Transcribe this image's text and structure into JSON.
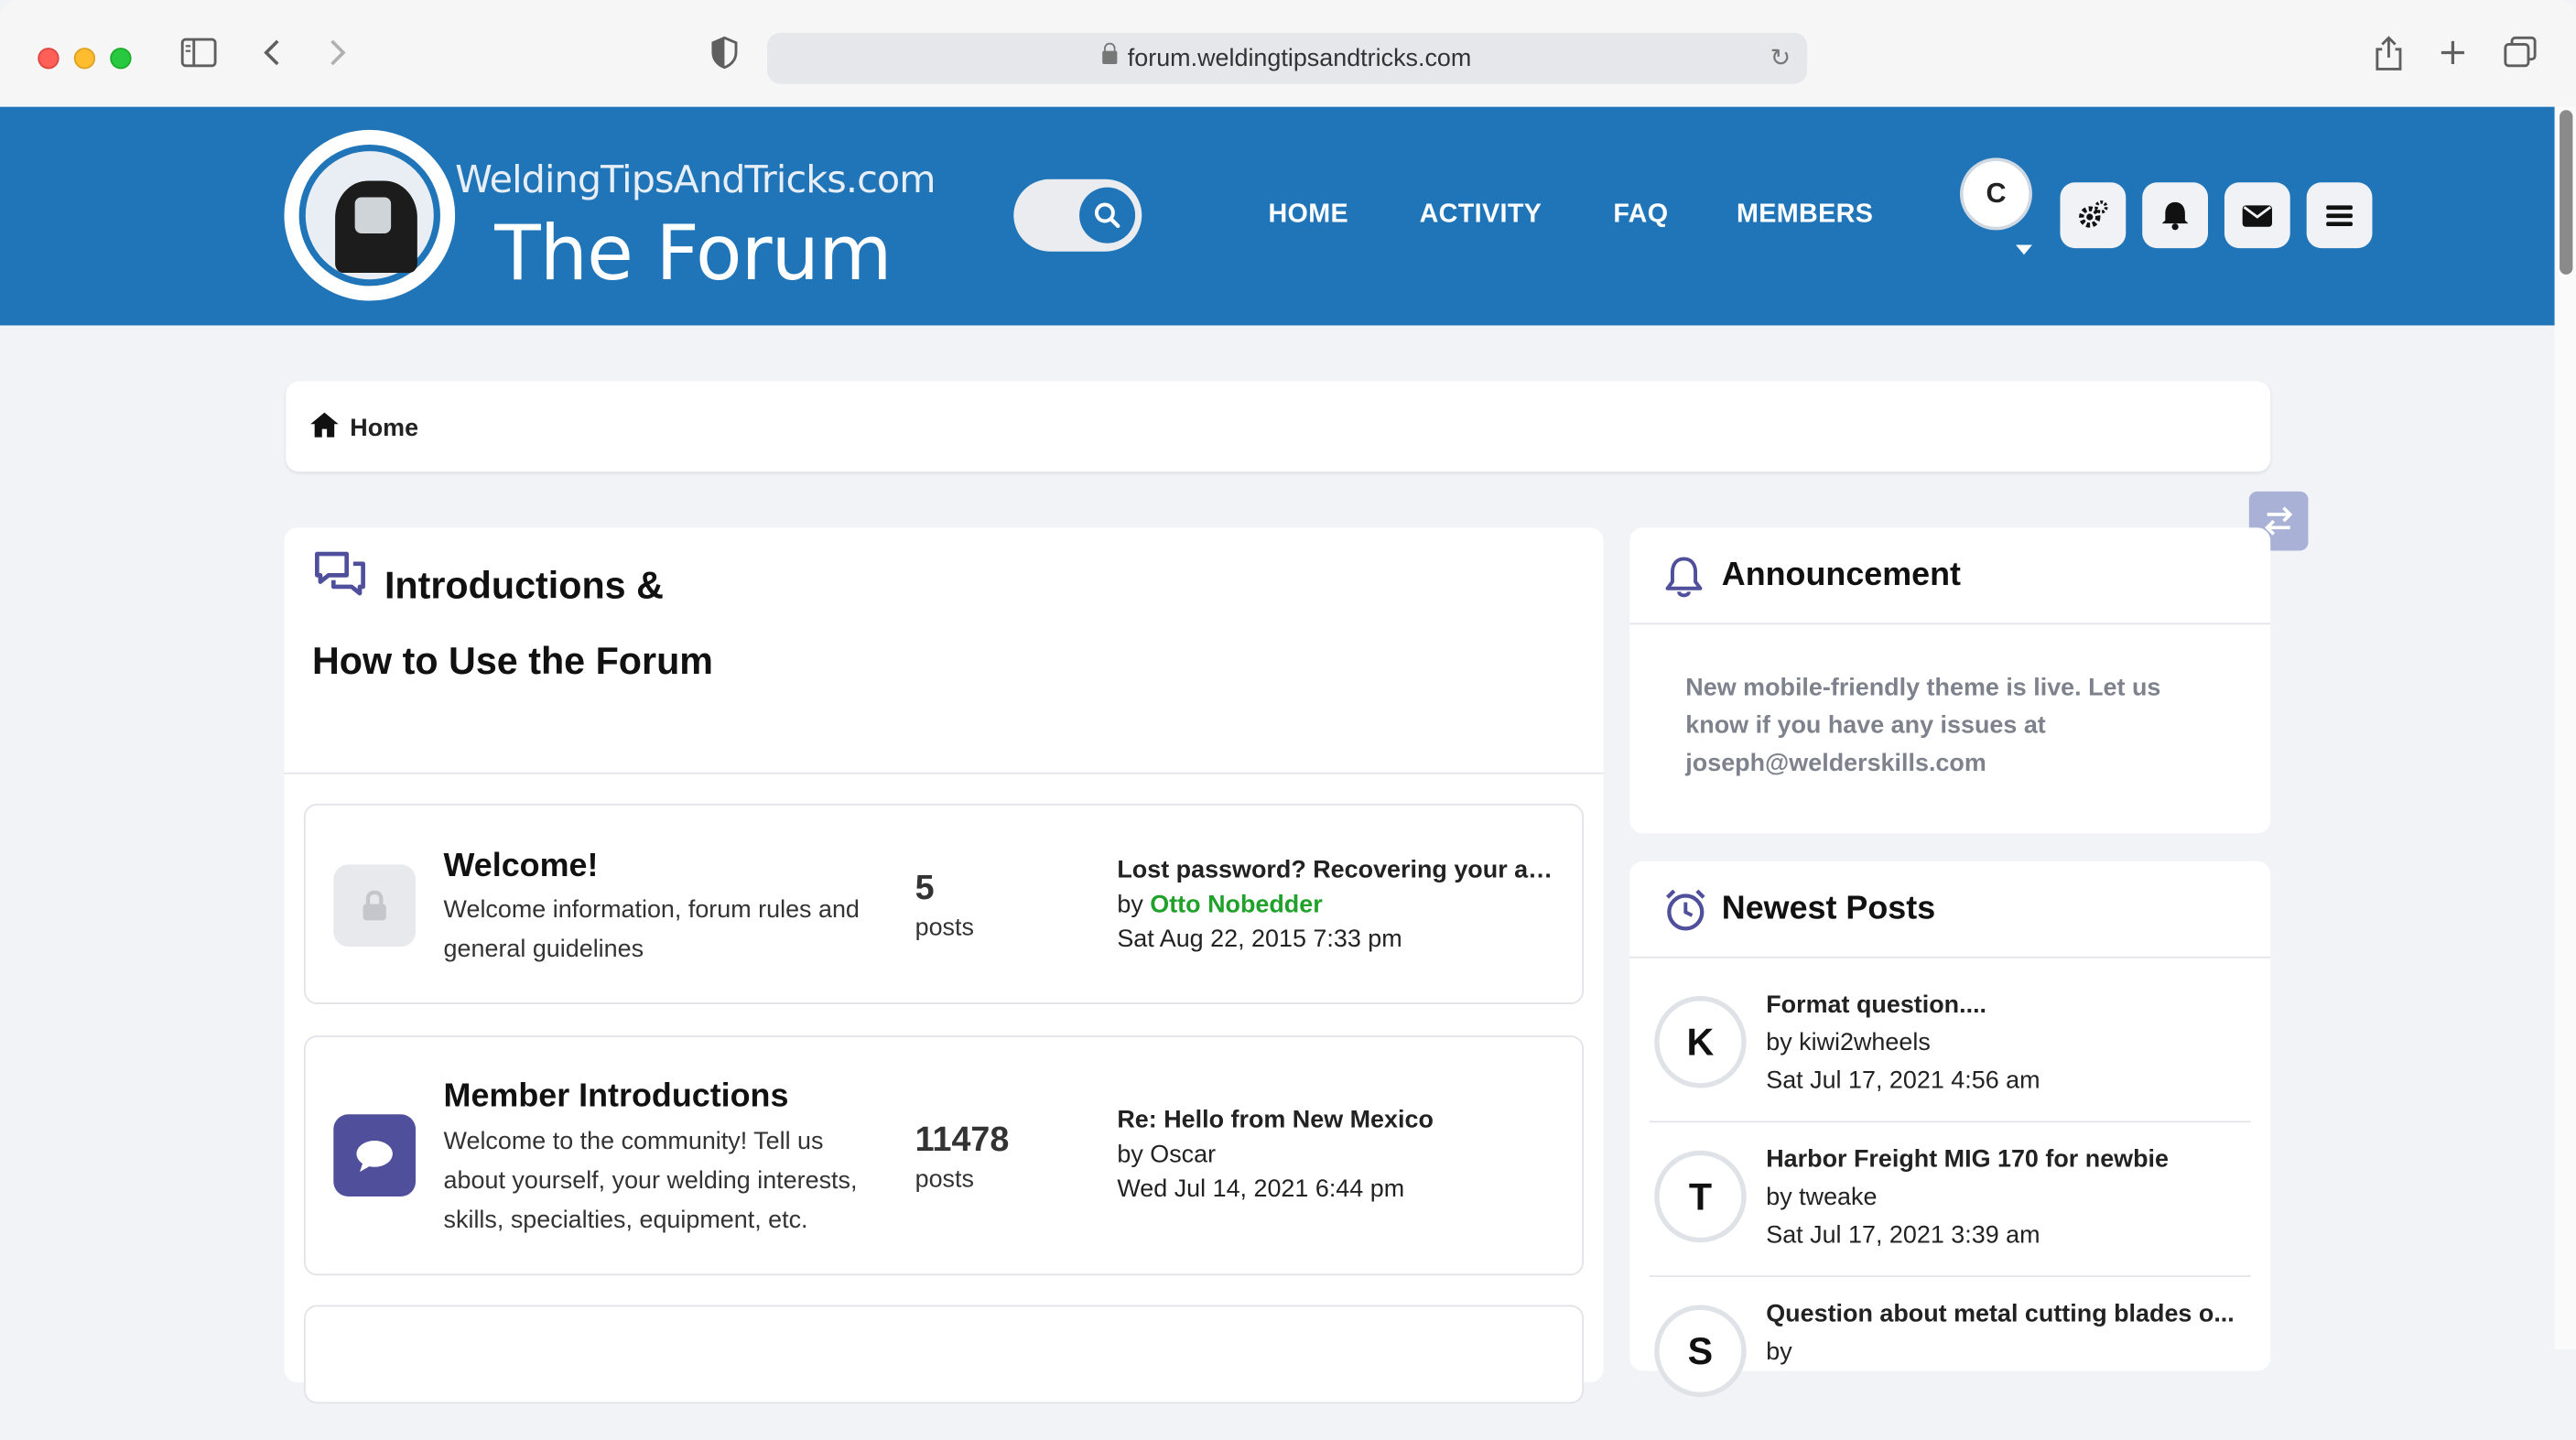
{
  "browser": {
    "url": "forum.weldingtipsandtricks.com"
  },
  "header": {
    "logo_top": "WeldingTipsAndTricks.com",
    "logo_main": "The Forum",
    "nav": [
      "HOME",
      "ACTIVITY",
      "FAQ",
      "MEMBERS"
    ],
    "avatar_initial": "C",
    "brand_color": "#1f75b8"
  },
  "breadcrumb": {
    "label": "Home"
  },
  "forum": {
    "title": "Introductions & How to Use the Forum",
    "rows": [
      {
        "title": "Welcome!",
        "description": "Welcome information, forum rules and general guidelines",
        "count": "5",
        "count_label": "posts",
        "last_title": "Lost password? Recovering your acc...",
        "last_by": "by",
        "last_author": "Otto Nobedder",
        "last_date": "Sat Aug 22, 2015 7:33 pm",
        "icon": "lock-icon"
      },
      {
        "title": "Member Introductions",
        "description": "Welcome to the community! Tell us about yourself, your welding interests, skills, specialties, equipment, etc.",
        "count": "11478",
        "count_label": "posts",
        "last_title": "Re: Hello from New Mexico",
        "last_by_author": "by Oscar",
        "last_date": "Wed Jul 14, 2021 6:44 pm",
        "icon": "chat-bubble-icon"
      }
    ]
  },
  "announcement": {
    "title": "Announcement",
    "text": "New mobile-friendly theme is live. Let us know if you have any issues at joseph@welderskills.com"
  },
  "newest": {
    "title": "Newest Posts",
    "items": [
      {
        "initial": "K",
        "title": "Format question....",
        "by": "by kiwi2wheels",
        "date": "Sat Jul 17, 2021 4:56 am"
      },
      {
        "initial": "T",
        "title": "Harbor Freight MIG 170 for newbie",
        "by": "by tweake",
        "date": "Sat Jul 17, 2021 3:39 am"
      },
      {
        "initial": "S",
        "title": "Question about metal cutting blades o...",
        "by": "by ",
        "date": ""
      }
    ]
  }
}
